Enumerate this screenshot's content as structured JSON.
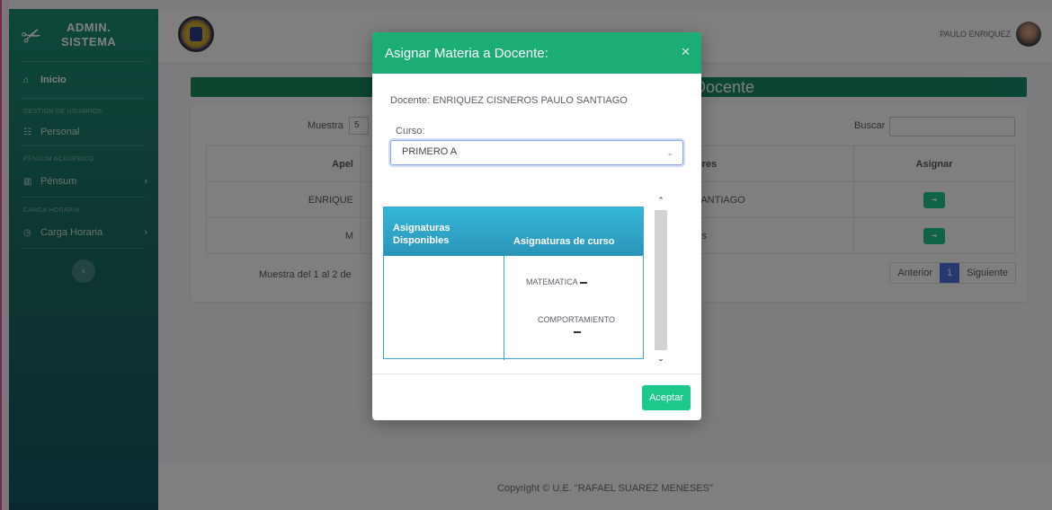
{
  "sidebar": {
    "brand_line1": "ADMIN.",
    "brand_line2": "SISTEMA",
    "items": [
      {
        "label": "Inicio"
      },
      {
        "heading": "GESTION DE USUARIOS"
      },
      {
        "label": "Personal"
      },
      {
        "heading": "PÉNSUM ACADÉMICO"
      },
      {
        "label": "Pénsum"
      },
      {
        "heading": "CARGA HORARIA"
      },
      {
        "label": "Carga Horaria"
      }
    ],
    "toggle_icon": "chevron-left-icon"
  },
  "topbar": {
    "user_name": "PAULO ENRIQUEZ"
  },
  "page": {
    "header_title": "Docente",
    "show_label": "Muestra",
    "show_value": "5",
    "search_label": "Buscar",
    "table": {
      "columns": [
        "Apel",
        "bres",
        "Asignar"
      ],
      "rows": [
        {
          "apellidos": "ENRIQUE",
          "nombres": "SANTIAGO"
        },
        {
          "apellidos": "M",
          "nombres": "uis"
        }
      ]
    },
    "info_text": "Muestra del 1 al 2 de",
    "pager": {
      "prev": "Anterior",
      "current": "1",
      "next": "Siguiente"
    }
  },
  "footer": {
    "copyright": "Copyright © U.E. \"RAFAEL SUAREZ MENESES\""
  },
  "modal": {
    "title": "Asignar Materia a Docente:",
    "docente": "Docente: ENRIQUEZ CISNEROS PAULO SANTIAGO",
    "curso_label": "Curso:",
    "curso_value": "PRIMERO A",
    "col_available_1": "Asignaturas",
    "col_available_2": "Disponibles",
    "col_course": "Asignaturas de curso",
    "course_subjects": [
      "MATEMATICA",
      "COMPORTAMIENTO"
    ],
    "accept_label": "Aceptar"
  },
  "colors": {
    "sidebar_top": "#1e8f75",
    "sidebar_bottom": "#155560",
    "modal_header": "#1cad75",
    "accept": "#1cc88a",
    "table_header": "#36b8d8"
  }
}
